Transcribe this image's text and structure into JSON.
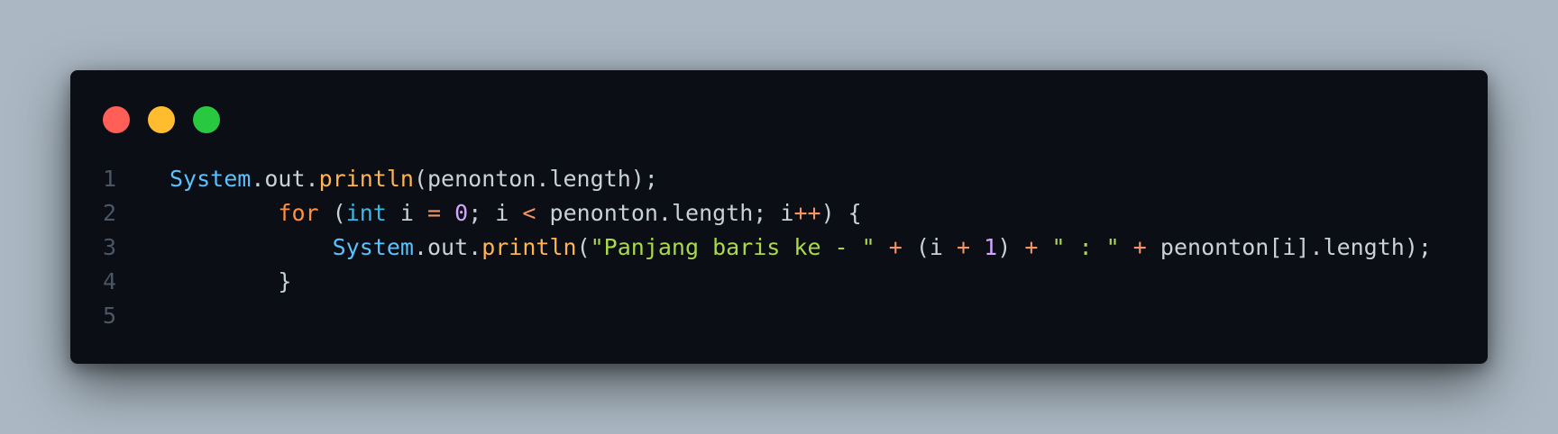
{
  "window": {
    "controls": [
      {
        "name": "close",
        "color": "#ff5f57"
      },
      {
        "name": "minimize",
        "color": "#febc2e"
      },
      {
        "name": "maximize",
        "color": "#28c840"
      }
    ]
  },
  "code": {
    "lines": [
      {
        "number": "1",
        "tokens": [
          {
            "text": "System",
            "kind": "class"
          },
          {
            "text": ".out.",
            "kind": "punc"
          },
          {
            "text": "println",
            "kind": "method"
          },
          {
            "text": "(penonton.length);",
            "kind": "punc"
          }
        ]
      },
      {
        "number": "2",
        "tokens": [
          {
            "text": "        ",
            "kind": "punc"
          },
          {
            "text": "for",
            "kind": "kw"
          },
          {
            "text": " (",
            "kind": "punc"
          },
          {
            "text": "int",
            "kind": "type"
          },
          {
            "text": " i ",
            "kind": "ident"
          },
          {
            "text": "=",
            "kind": "op"
          },
          {
            "text": " ",
            "kind": "punc"
          },
          {
            "text": "0",
            "kind": "num"
          },
          {
            "text": "; i ",
            "kind": "punc"
          },
          {
            "text": "<",
            "kind": "op"
          },
          {
            "text": " penonton.length; i",
            "kind": "punc"
          },
          {
            "text": "++",
            "kind": "op"
          },
          {
            "text": ") {",
            "kind": "punc"
          }
        ]
      },
      {
        "number": "3",
        "tokens": [
          {
            "text": "            ",
            "kind": "punc"
          },
          {
            "text": "System",
            "kind": "class"
          },
          {
            "text": ".out.",
            "kind": "punc"
          },
          {
            "text": "println",
            "kind": "method"
          },
          {
            "text": "(",
            "kind": "punc"
          },
          {
            "text": "\"Panjang baris ke - \"",
            "kind": "str"
          },
          {
            "text": " ",
            "kind": "punc"
          },
          {
            "text": "+",
            "kind": "op"
          },
          {
            "text": " (i ",
            "kind": "punc"
          },
          {
            "text": "+",
            "kind": "op"
          },
          {
            "text": " ",
            "kind": "punc"
          },
          {
            "text": "1",
            "kind": "num"
          },
          {
            "text": ") ",
            "kind": "punc"
          },
          {
            "text": "+",
            "kind": "op"
          },
          {
            "text": " ",
            "kind": "punc"
          },
          {
            "text": "\" : \"",
            "kind": "str"
          },
          {
            "text": " ",
            "kind": "punc"
          },
          {
            "text": "+",
            "kind": "op"
          },
          {
            "text": " penonton[i].length);",
            "kind": "punc"
          }
        ]
      },
      {
        "number": "4",
        "tokens": [
          {
            "text": "        }",
            "kind": "punc"
          }
        ]
      },
      {
        "number": "5",
        "tokens": []
      }
    ]
  }
}
